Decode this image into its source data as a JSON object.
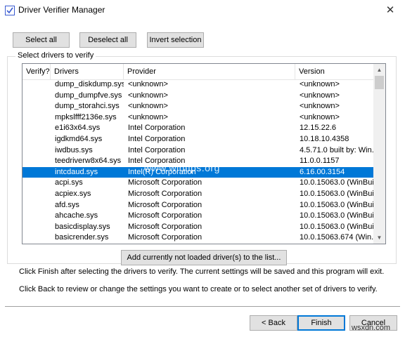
{
  "window": {
    "title": "Driver Verifier Manager"
  },
  "toolbar": {
    "select_all": "Select all",
    "deselect_all": "Deselect all",
    "invert_selection": "Invert selection"
  },
  "group": {
    "label": "Select drivers to verify"
  },
  "table": {
    "columns": [
      "Verify?",
      "Drivers",
      "Provider",
      "Version"
    ],
    "rows": [
      {
        "checked": true,
        "driver": "dump_diskdump.sys",
        "provider": "<unknown>",
        "version": "<unknown>"
      },
      {
        "checked": true,
        "driver": "dump_dumpfve.sys",
        "provider": "<unknown>",
        "version": "<unknown>"
      },
      {
        "checked": true,
        "driver": "dump_storahci.sys",
        "provider": "<unknown>",
        "version": "<unknown>"
      },
      {
        "checked": true,
        "driver": "mpkslfff2136e.sys",
        "provider": "<unknown>",
        "version": "<unknown>"
      },
      {
        "checked": true,
        "driver": "e1i63x64.sys",
        "provider": "Intel Corporation",
        "version": "12.15.22.6"
      },
      {
        "checked": true,
        "driver": "igdkmd64.sys",
        "provider": "Intel Corporation",
        "version": "10.18.10.4358"
      },
      {
        "checked": true,
        "driver": "iwdbus.sys",
        "provider": "Intel Corporation",
        "version": "4.5.71.0 built by: Win..."
      },
      {
        "checked": true,
        "driver": "teedriverw8x64.sys",
        "provider": "Intel Corporation",
        "version": "11.0.0.1157"
      },
      {
        "checked": true,
        "driver": "intcdaud.sys",
        "provider": "Intel(R) Corporation",
        "version": "6.16.00.3154",
        "selected": true
      },
      {
        "checked": false,
        "driver": "acpi.sys",
        "provider": "Microsoft Corporation",
        "version": "10.0.15063.0 (WinBui..."
      },
      {
        "checked": false,
        "driver": "acpiex.sys",
        "provider": "Microsoft Corporation",
        "version": "10.0.15063.0 (WinBui..."
      },
      {
        "checked": false,
        "driver": "afd.sys",
        "provider": "Microsoft Corporation",
        "version": "10.0.15063.0 (WinBui..."
      },
      {
        "checked": false,
        "driver": "ahcache.sys",
        "provider": "Microsoft Corporation",
        "version": "10.0.15063.0 (WinBui..."
      },
      {
        "checked": false,
        "driver": "basicdisplay.sys",
        "provider": "Microsoft Corporation",
        "version": "10.0.15063.0 (WinBui..."
      },
      {
        "checked": false,
        "driver": "basicrender.sys",
        "provider": "Microsoft Corporation",
        "version": "10.0.15063.674 (Win..."
      }
    ]
  },
  "add_button": "Add currently not loaded driver(s) to the list...",
  "info": {
    "line1": "Click Finish after selecting the drivers to verify. The current settings will be saved and this program will exit.",
    "line2": "Click Back to review or change the settings you want to create or to select another set of drivers to verify."
  },
  "footer": {
    "back": "< Back",
    "finish": "Finish",
    "cancel": "Cancel"
  },
  "watermark": "www.wintips.org",
  "corner_mark": "wsxdn.com",
  "colors": {
    "selection": "#0078d7",
    "button_face": "#e1e1e1"
  }
}
